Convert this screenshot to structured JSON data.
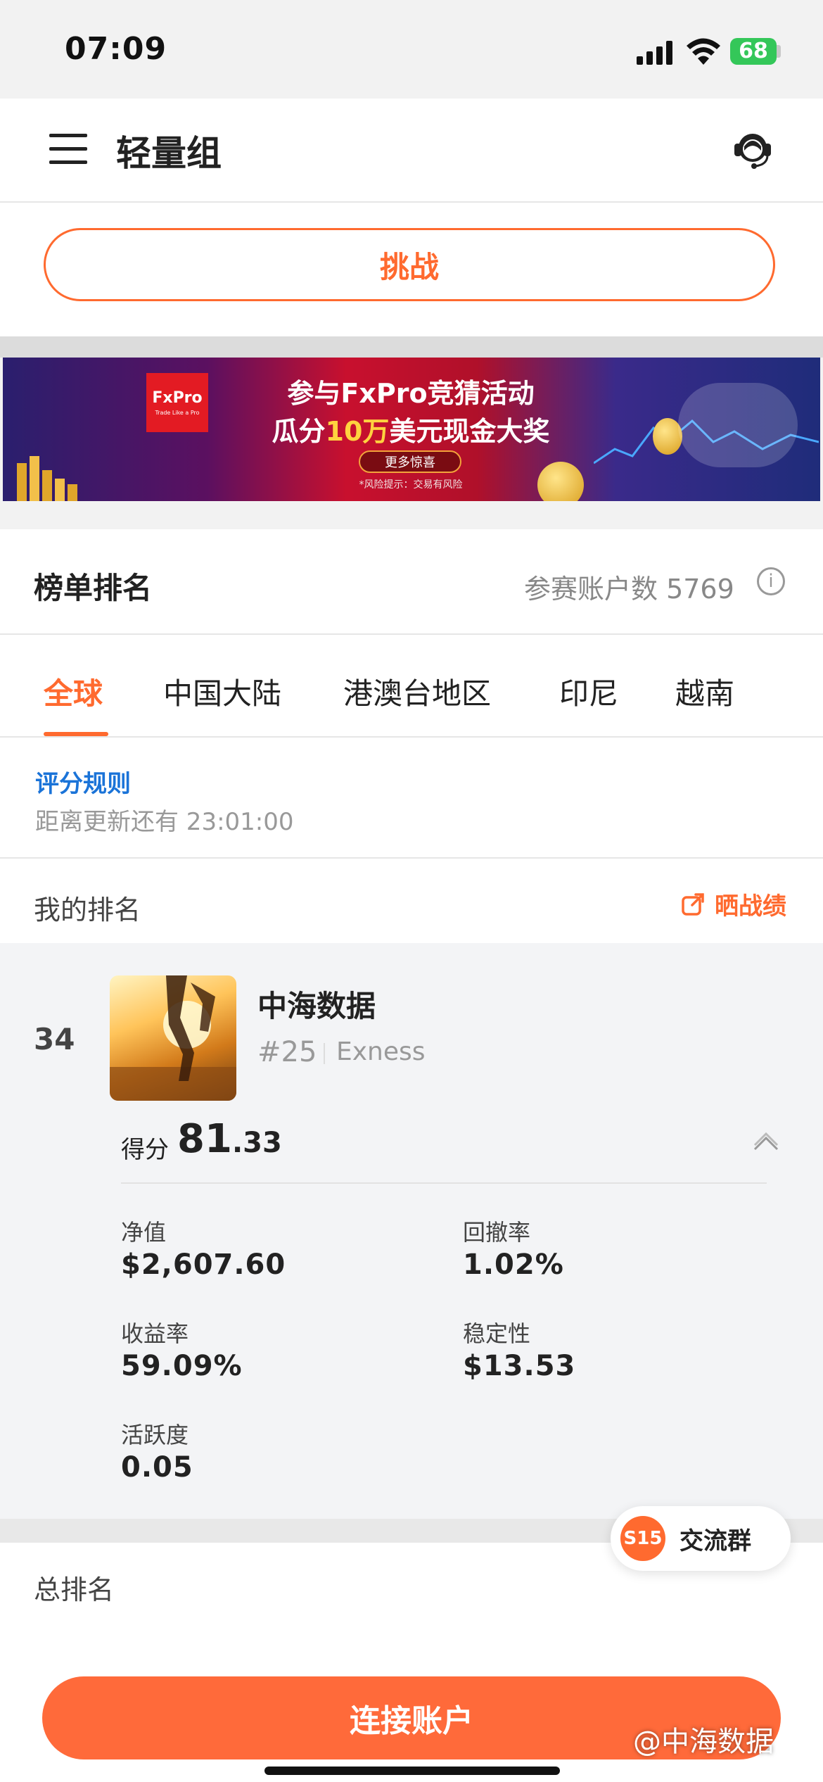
{
  "status": {
    "time": "07:09",
    "battery": "68"
  },
  "header": {
    "title": "轻量组"
  },
  "challenge": {
    "label": "挑战"
  },
  "banner": {
    "logo": "FxPro",
    "logo_tagline": "Trade Like a Pro",
    "line1": "参与FxPro竞猜活动",
    "line2_pre": "瓜分",
    "line2_highlight": "10万",
    "line2_post": "美元现金大奖",
    "more": "更多惊喜",
    "risk": "*风险提示：交易有风险"
  },
  "leaderboard": {
    "title": "榜单排名",
    "count_label": "参赛账户数 5769",
    "info": "i",
    "tabs": [
      "全球",
      "中国大陆",
      "港澳台地区",
      "印尼",
      "越南"
    ],
    "rules_link": "评分规则",
    "update_text": "距离更新还有 23:01:00"
  },
  "my_rank": {
    "title": "我的排名",
    "share": "晒战绩",
    "rank": "34",
    "name": "中海数据",
    "id": "#25",
    "broker": "Exness",
    "score_label": "得分",
    "score_int": "81",
    "score_dec": ".33",
    "metrics": [
      {
        "label": "净值",
        "value": "$2,607.60"
      },
      {
        "label": "回撤率",
        "value": "1.02%"
      },
      {
        "label": "收益率",
        "value": "59.09%"
      },
      {
        "label": "稳定性",
        "value": "$13.53"
      },
      {
        "label": "活跃度",
        "value": "0.05"
      }
    ]
  },
  "total": {
    "title": "总排名"
  },
  "chat": {
    "badge": "S15",
    "label": "交流群"
  },
  "bottom": {
    "connect": "连接账户",
    "watermark": "@中海数据"
  },
  "colors": {
    "accent": "#ff6a2f",
    "link": "#1a73d8"
  }
}
